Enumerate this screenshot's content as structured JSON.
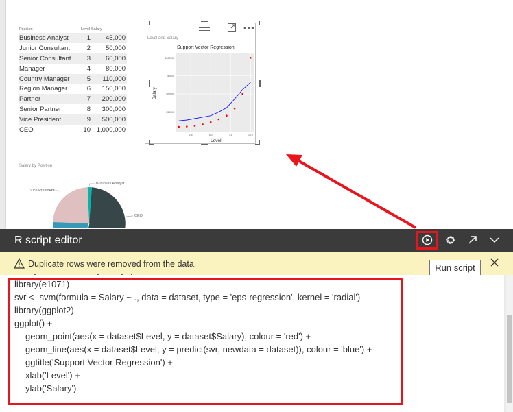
{
  "table": {
    "headers": [
      "Position",
      "Level",
      "Salary"
    ],
    "rows": [
      [
        "Business Analyst",
        "1",
        "45,000"
      ],
      [
        "Junior Consultant",
        "2",
        "50,000"
      ],
      [
        "Senior Consultant",
        "3",
        "60,000"
      ],
      [
        "Manager",
        "4",
        "80,000"
      ],
      [
        "Country Manager",
        "5",
        "110,000"
      ],
      [
        "Region Manager",
        "6",
        "150,000"
      ],
      [
        "Partner",
        "7",
        "200,000"
      ],
      [
        "Senior Partner",
        "8",
        "300,000"
      ],
      [
        "Vice President",
        "9",
        "500,000"
      ],
      [
        "CEO",
        "10",
        "1,000,000"
      ]
    ]
  },
  "visual": {
    "title": "Level and Salary",
    "icons": [
      "hamburger-icon",
      "focus-mode-icon",
      "more-options-icon"
    ]
  },
  "chart_data": {
    "type": "scatter",
    "title": "Support Vector Regression",
    "xlabel": "Level",
    "ylabel": "Salary",
    "x_ticks": [
      "2.5",
      "5.0",
      "7.5",
      "10.0"
    ],
    "y_ticks": [
      "250000",
      "500000",
      "750000",
      "1000000"
    ],
    "xlim": [
      1,
      10
    ],
    "ylim": [
      0,
      1000000
    ],
    "series": [
      {
        "color": "#ff0000",
        "mode": "points",
        "x": [
          1,
          2,
          3,
          4,
          5,
          6,
          7,
          8,
          9,
          10
        ],
        "y": [
          45000,
          50000,
          60000,
          80000,
          110000,
          150000,
          200000,
          300000,
          500000,
          1000000
        ]
      },
      {
        "color": "#0000ff",
        "mode": "line",
        "x": [
          1,
          2,
          3,
          4,
          5,
          6,
          7,
          8,
          9,
          10
        ],
        "y": [
          130000,
          140000,
          160000,
          180000,
          200000,
          250000,
          310000,
          430000,
          560000,
          660000
        ]
      }
    ]
  },
  "pie": {
    "title": "Salary by Position",
    "labels": {
      "vp": "Vice President",
      "ba": "Business Analyst",
      "ceo": "CEO"
    }
  },
  "editor": {
    "title": "R script editor",
    "warning": "Duplicate rows were removed from the data.",
    "tooltip": "Run script",
    "code": [
      "library(e1071)",
      "svr <- svm(formula = Salary ~ ., data = dataset, type = 'eps-regression', kernel = 'radial')",
      "library(ggplot2)",
      "ggplot() +",
      "geom_point(aes(x = dataset$Level, y = dataset$Salary), colour = 'red') +",
      "geom_line(aes(x = dataset$Level, y = predict(svr, newdata = dataset)), colour = 'blue') +",
      "ggtitle('Support Vector Regression') +",
      "xlab('Level') +",
      "ylab('Salary')"
    ]
  },
  "colors": {
    "highlight": "#e8141e",
    "editor_bar": "#3b3b3b",
    "warning_bg": "#fbf3bf"
  }
}
